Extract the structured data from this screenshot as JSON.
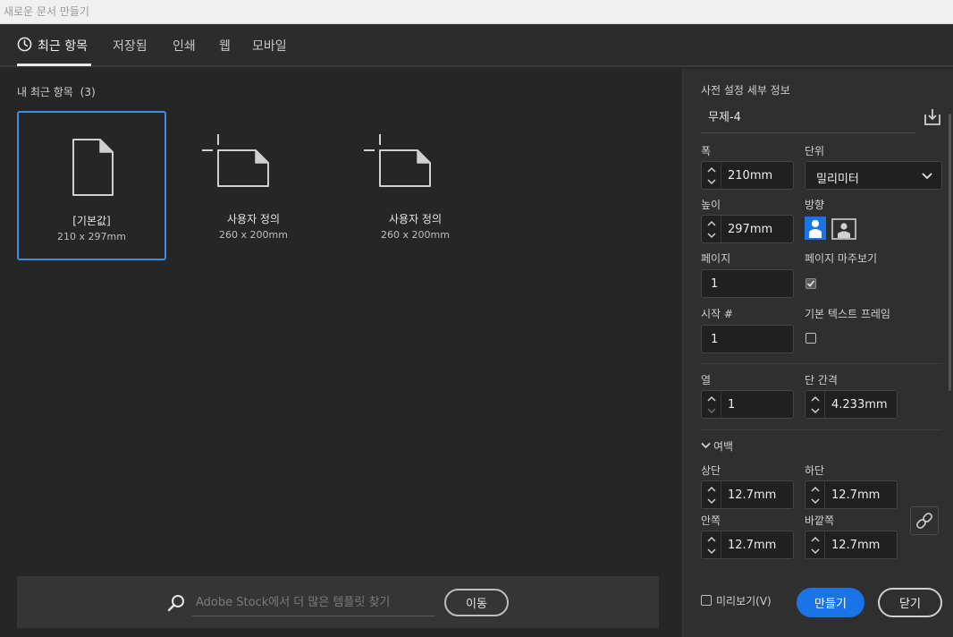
{
  "window": {
    "title": "새로운 문서 만들기"
  },
  "tabs": [
    {
      "label": "최근 항목",
      "active": true
    },
    {
      "label": "저장됨"
    },
    {
      "label": "인쇄"
    },
    {
      "label": "웹"
    },
    {
      "label": "모바일"
    }
  ],
  "recent": {
    "title": "내 최근 항목",
    "count": "(3)",
    "items": [
      {
        "name": "[기본값]",
        "size": "210 x 297mm",
        "selected": true,
        "icon": "document-icon"
      },
      {
        "name": "사용자 정의",
        "size": "260 x 200mm",
        "icon": "custom-size-icon"
      },
      {
        "name": "사용자 정의",
        "size": "260 x 200mm",
        "icon": "custom-size-icon"
      }
    ]
  },
  "stock_search": {
    "placeholder": "Adobe Stock에서 더 많은 템플릿 찾기",
    "go_label": "이동"
  },
  "preset": {
    "header": "사전 설정 세부 정보",
    "name": "무제-4",
    "width_label": "폭",
    "width_value": "210mm",
    "units_label": "단위",
    "units_value": "밀리미터",
    "height_label": "높이",
    "height_value": "297mm",
    "orientation_label": "방향",
    "pages_label": "페이지",
    "pages_value": "1",
    "facing_pages_label": "페이지 마주보기",
    "facing_pages_checked": true,
    "start_label": "시작 #",
    "start_value": "1",
    "primary_text_frame_label": "기본 텍스트 프레임",
    "primary_text_frame_checked": false,
    "columns_label": "열",
    "columns_value": "1",
    "gutter_label": "단 간격",
    "gutter_value": "4.233mm",
    "margins_label": "여백",
    "top_label": "상단",
    "top_value": "12.7mm",
    "bottom_label": "하단",
    "bottom_value": "12.7mm",
    "inside_label": "안쪽",
    "inside_value": "12.7mm",
    "outside_label": "바깥쪽",
    "outside_value": "12.7mm"
  },
  "footer": {
    "preview_label": "미리보기(V)",
    "create_label": "만들기",
    "close_label": "닫기"
  },
  "colors": {
    "accent": "#1b73e8",
    "selection": "#3a8fe8",
    "background": "#262626",
    "panel": "#2f2f2f"
  }
}
